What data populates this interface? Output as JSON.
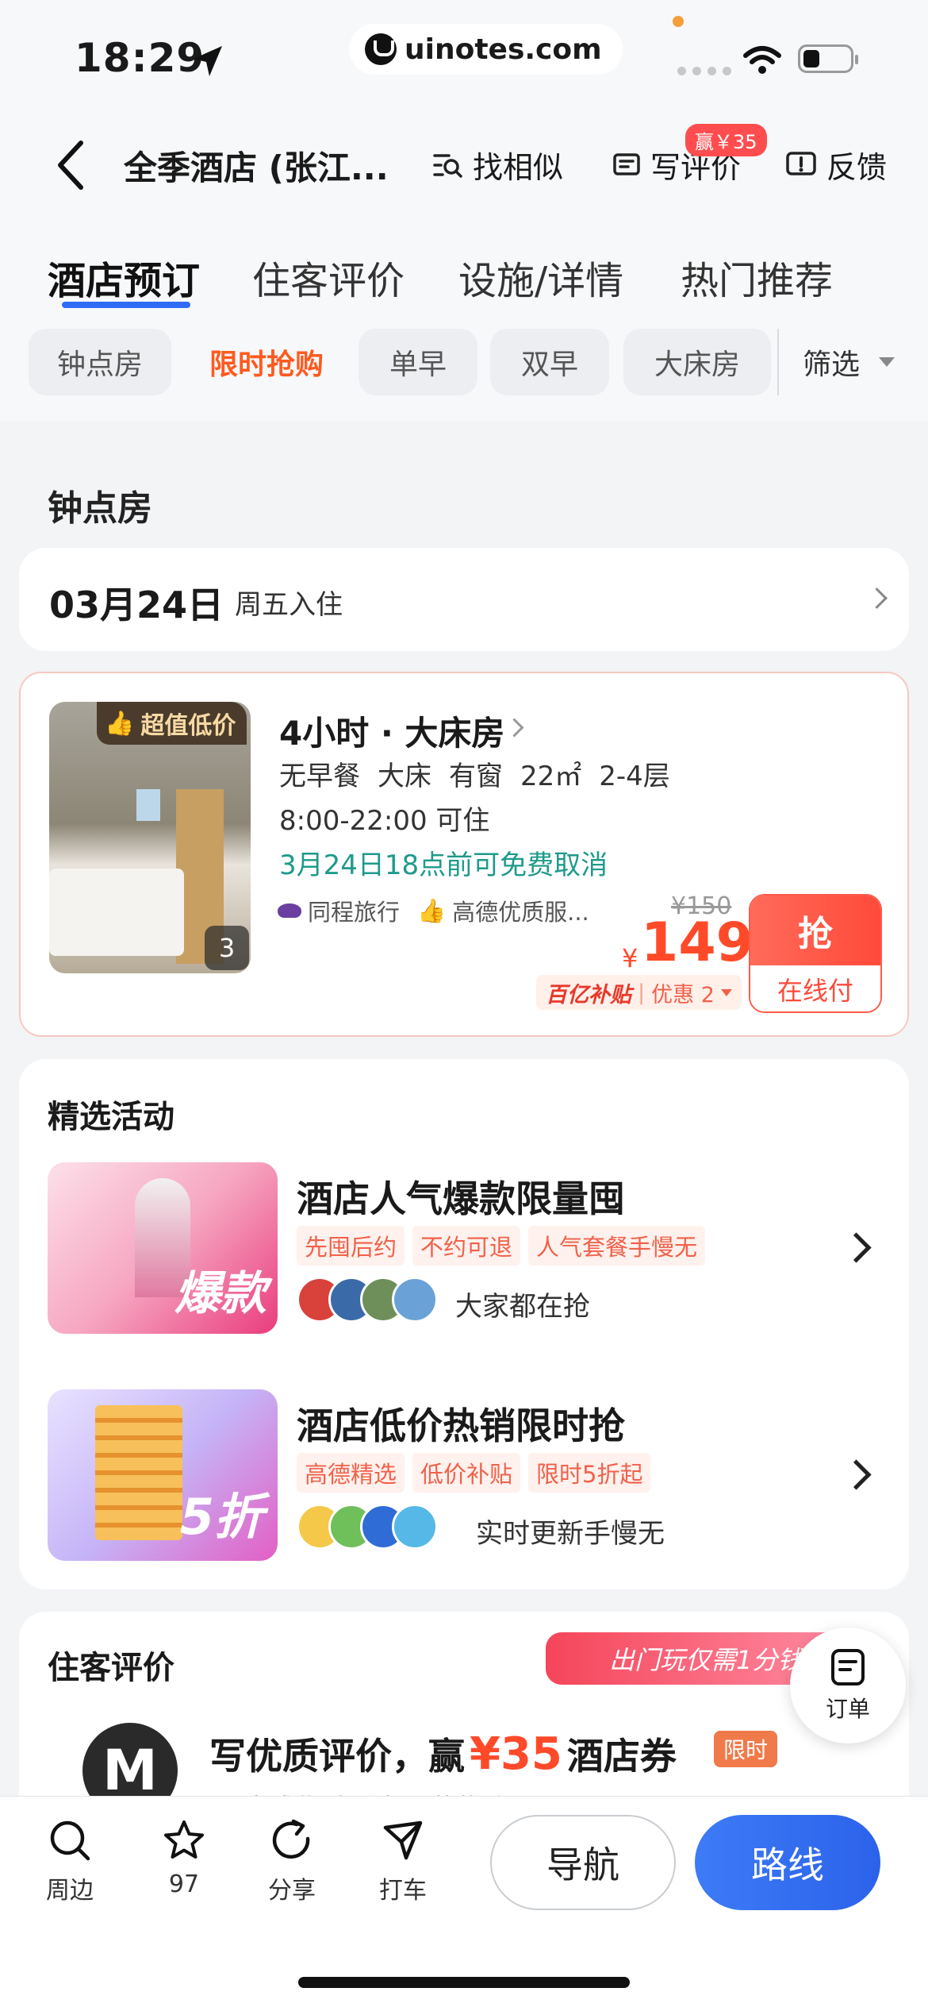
{
  "status": {
    "time": "18:29",
    "url": "uinotes.com"
  },
  "nav": {
    "title": "全季酒店 (张江...",
    "find_similar": "找相似",
    "write_review": "写评价",
    "review_badge": "赢￥35",
    "feedback": "反馈"
  },
  "tabs": [
    "酒店预订",
    "住客评价",
    "设施/详情",
    "热门推荐"
  ],
  "chips": [
    "钟点房",
    "限时抢购",
    "单早",
    "双早",
    "大床房"
  ],
  "filter_label": "筛选",
  "hourly": {
    "section_title": "钟点房",
    "date": "03月24日",
    "checkin_note": "周五入住",
    "room": {
      "badge": "超值低价",
      "photo_count": "3",
      "title": "4小时 · 大床房",
      "features": [
        "无早餐",
        "大床",
        "有窗",
        "22㎡",
        "2-4层"
      ],
      "hours": "8:00-22:00 可住",
      "cancel": "3月24日18点前可免费取消",
      "provider": "同程旅行",
      "quality": "高德优质服...",
      "orig_price": "¥150",
      "currency": "¥",
      "price": "149",
      "subsidy_label": "百亿补贴",
      "discount": "优惠 2",
      "grab": "抢",
      "pay": "在线付"
    }
  },
  "activities": {
    "title": "精选活动",
    "items": [
      {
        "title": "酒店人气爆款限量囤",
        "banner": "爆款",
        "tags": [
          "先囤后约",
          "不约可退",
          "人气套餐手慢无"
        ],
        "note": "大家都在抢"
      },
      {
        "title": "酒店低价热销限时抢",
        "banner": "5折",
        "tags": [
          "高德精选",
          "低价补贴",
          "限时5折起"
        ],
        "note": "实时更新手慢无"
      }
    ]
  },
  "reviews": {
    "title": "住客评价",
    "promo_banner": "出门玩仅需1分钱",
    "cta_prefix": "写优质评价，赢",
    "cta_amount": "¥35",
    "cta_suffix": "酒店券",
    "limited": "限时",
    "sub": "**完成优质评论 已获奖励"
  },
  "float_order": "订单",
  "bottom": {
    "items": [
      {
        "label": "周边",
        "icon": "search-icon"
      },
      {
        "label": "97",
        "icon": "star-icon"
      },
      {
        "label": "分享",
        "icon": "share-icon"
      },
      {
        "label": "打车",
        "icon": "taxi-icon"
      }
    ],
    "navigate": "导航",
    "route": "路线"
  }
}
